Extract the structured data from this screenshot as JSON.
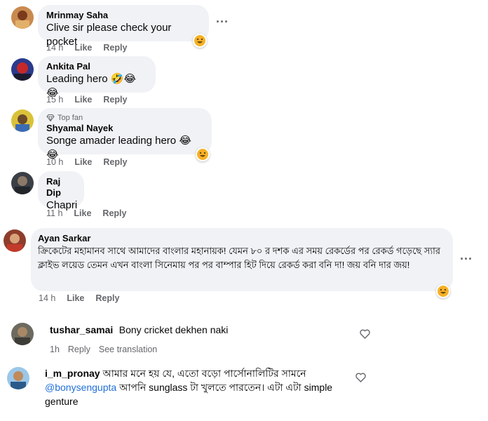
{
  "comments": [
    {
      "name": "Mrinmay Saha",
      "text": "Clive sir please check your pocket",
      "time": "14 h",
      "like": "Like",
      "reply": "Reply"
    },
    {
      "name": "Ankita Pal",
      "text": "Leading hero",
      "time": "15 h",
      "like": "Like",
      "reply": "Reply"
    },
    {
      "badge": "Top fan",
      "name": "Shyamal Nayek",
      "text": "Songe amader leading hero",
      "time": "10 h",
      "like": "Like",
      "reply": "Reply"
    },
    {
      "name": "Raj Dip",
      "text": "Chapri",
      "time": "11 h",
      "like": "Like",
      "reply": "Reply"
    },
    {
      "name": "Ayan Sarkar",
      "text": "ক্রিকেটের মহামানব সাথে আমাদের বাংলার মহানায়ক! যেমন ৮০ র দশক এর সময় রেকর্ডের পর রেকর্ড গড়েছে স্যার ক্লাইভ লয়েড তেমন এখন বাংলা সিনেমায় পর পর বাম্পার হিট দিয়ে রেকর্ড করা বনি দা! জয় বনি দার জয়!",
      "time": "14 h",
      "like": "Like",
      "reply": "Reply"
    }
  ],
  "plain_comments": [
    {
      "name": "tushar_samai",
      "text": "Bony cricket dekhen naki",
      "time": "1h",
      "reply": "Reply",
      "translate": "See translation"
    },
    {
      "name": "i_m_pronay",
      "text_before": "আমার মনে হয় যে, এতো বড়ো পার্সোনালিটির সামনে",
      "mention": "@bonysengupta",
      "text_after": "আপনি sunglass টা খুলতে পারতেন। এটা এটা simple genture"
    }
  ],
  "colors": {
    "bubble": "#f0f2f5",
    "meta": "#65676b",
    "mention": "#216fdb",
    "heart": "#65676b"
  },
  "icons": [
    "more-options-icon",
    "laugh-reaction-icon",
    "rolling-laugh-emoji",
    "tears-of-joy-emoji",
    "diamond-icon",
    "heart-outline-icon"
  ]
}
